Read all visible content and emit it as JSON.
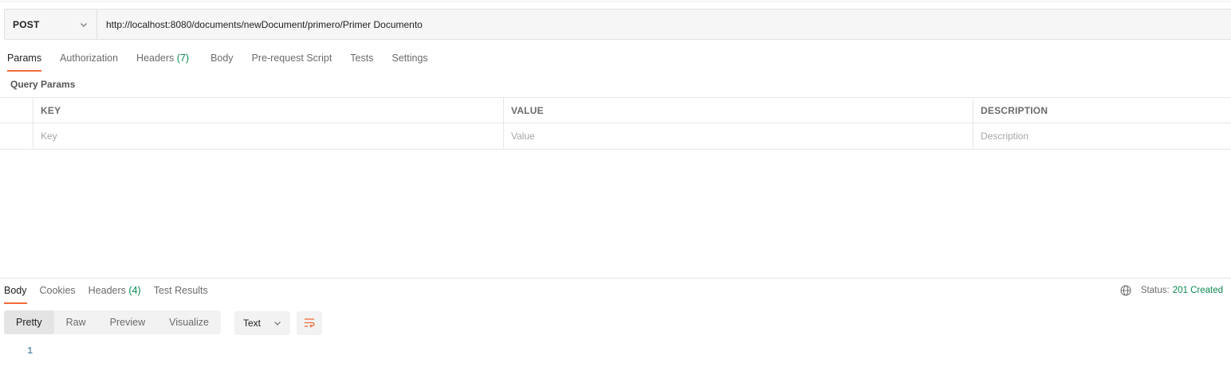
{
  "request": {
    "method": "POST",
    "url": "http://localhost:8080/documents/newDocument/primero/Primer Documento"
  },
  "request_tabs": [
    {
      "label": "Params",
      "count": "",
      "active": true
    },
    {
      "label": "Authorization",
      "count": "",
      "active": false
    },
    {
      "label": "Headers",
      "count": "(7)",
      "active": false
    },
    {
      "label": "Body",
      "count": "",
      "active": false
    },
    {
      "label": "Pre-request Script",
      "count": "",
      "active": false
    },
    {
      "label": "Tests",
      "count": "",
      "active": false
    },
    {
      "label": "Settings",
      "count": "",
      "active": false
    }
  ],
  "query_params": {
    "title": "Query Params",
    "columns": {
      "key": "KEY",
      "value": "VALUE",
      "description": "DESCRIPTION"
    },
    "placeholders": {
      "key": "Key",
      "value": "Value",
      "description": "Description"
    }
  },
  "response_tabs": [
    {
      "label": "Body",
      "count": "",
      "active": true
    },
    {
      "label": "Cookies",
      "count": "",
      "active": false
    },
    {
      "label": "Headers",
      "count": "(4)",
      "active": false
    },
    {
      "label": "Test Results",
      "count": "",
      "active": false
    }
  ],
  "response_status": {
    "label": "Status:",
    "value": "201 Created"
  },
  "format_buttons": [
    {
      "label": "Pretty",
      "active": true
    },
    {
      "label": "Raw",
      "active": false
    },
    {
      "label": "Preview",
      "active": false
    },
    {
      "label": "Visualize",
      "active": false
    }
  ],
  "language": "Text",
  "editor": {
    "line_numbers": [
      "1"
    ]
  },
  "icons": {
    "method_dropdown": "chevron-down-icon",
    "language_dropdown": "chevron-down-icon",
    "globe": "globe-icon",
    "wrap": "wrap-lines-icon"
  },
  "colors": {
    "accent": "#f26b3a",
    "success": "#0a8a4f",
    "line_number": "#2a6e97"
  }
}
